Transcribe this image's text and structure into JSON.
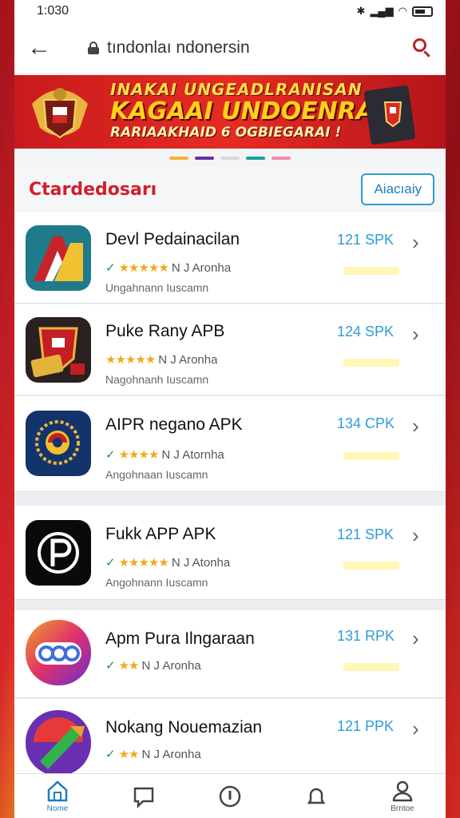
{
  "status": {
    "time": "1:030"
  },
  "appbar": {
    "url": "tındonlaı ndonersin"
  },
  "banner": {
    "line1": "INAKAI UNGEADLRANISAN",
    "line2": "KAGAAI UNDOENRAAI",
    "line3": "RARIAAKHAID 6 OGBIEGARAI !"
  },
  "carousel_colors": [
    "#f2b23a",
    "#6a2fa0",
    "#d9d9e0",
    "#1aa39a",
    "#f08bb0"
  ],
  "section": {
    "title": "Ctardedosarı",
    "button": "Aiacıaiy"
  },
  "apps": [
    {
      "name": "Devl Pedainacilan",
      "stars": "★★★★★",
      "rating_text": "N J Aronha",
      "developer": "Ungahnann Iuscamn",
      "size": "121 SPK"
    },
    {
      "name": "Puke Rany  APB",
      "stars": "★★★★★",
      "rating_text": "N J Aronha",
      "developer": "Nagohnanh Iuscamn",
      "size": "124 SPK"
    },
    {
      "name": "AIPR negano APK",
      "stars": "★★★★",
      "rating_text": "N J Atornha",
      "developer": "Angohnaan Iuscamn",
      "size": "134 CPK"
    },
    {
      "name": "Fukk APP  APK",
      "stars": "★★★★★",
      "rating_text": "N J Atonha",
      "developer": "Angohnann Iuscamn",
      "size": "121 SPK"
    },
    {
      "name": "Apm Pura Ilngaraan",
      "stars": "★★",
      "rating_text": "N J Aronha",
      "developer": "",
      "size": "131 RPK"
    },
    {
      "name": "Nokang Nouemazian",
      "stars": "★★",
      "rating_text": "N J Aronha",
      "developer": "",
      "size": "121 PPK"
    }
  ],
  "nav": {
    "home": "Nome",
    "profile": "Brntoe"
  }
}
